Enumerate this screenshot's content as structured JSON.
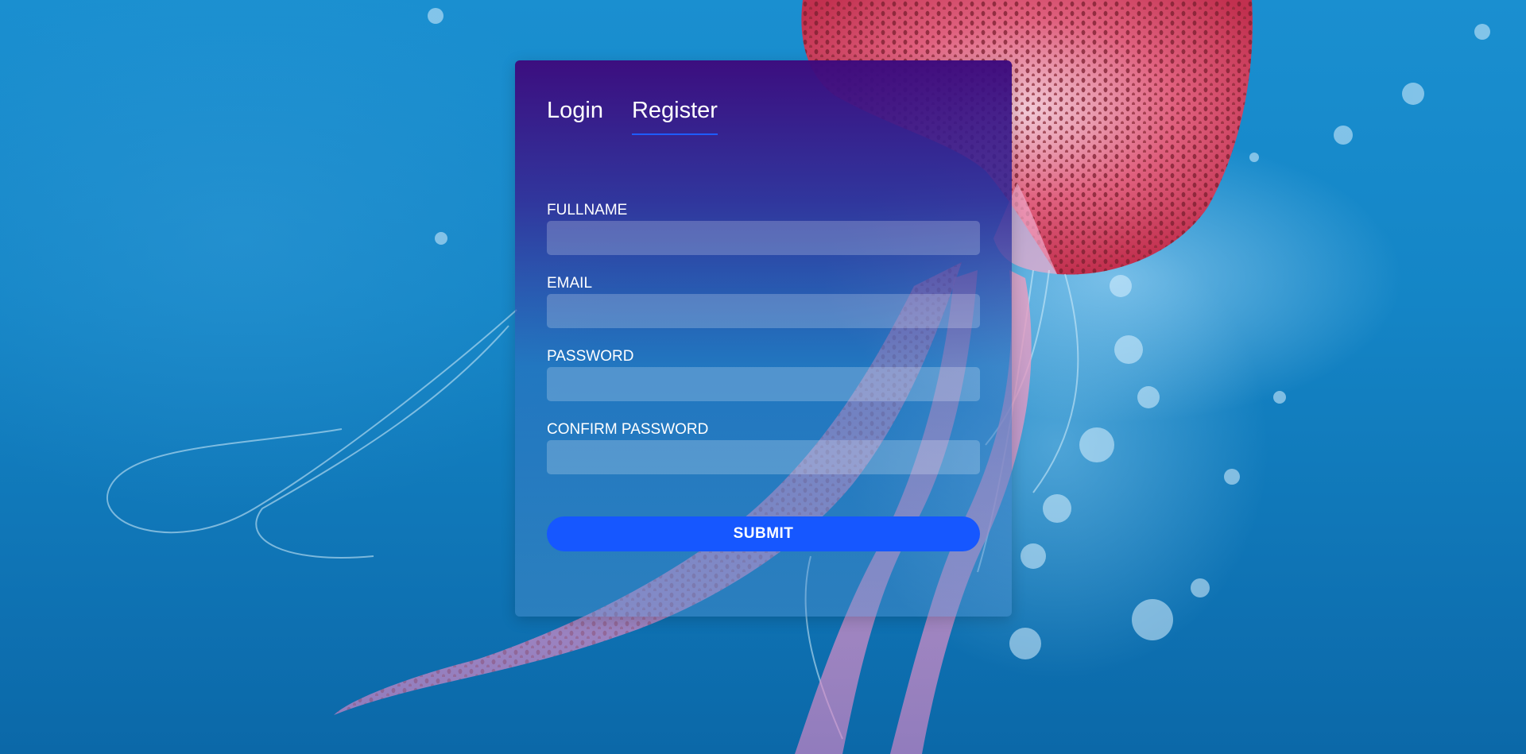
{
  "tabs": [
    {
      "label": "Login",
      "active": false
    },
    {
      "label": "Register",
      "active": true
    }
  ],
  "form": {
    "fields": [
      {
        "label": "FULLNAME",
        "value": "",
        "placeholder": ""
      },
      {
        "label": "EMAIL",
        "value": "",
        "placeholder": ""
      },
      {
        "label": "PASSWORD",
        "value": "",
        "placeholder": ""
      },
      {
        "label": "CONFIRM PASSWORD",
        "value": "",
        "placeholder": ""
      }
    ],
    "submit_label": "SUBMIT"
  },
  "colors": {
    "accent": "#1657ff",
    "card_top": "#3d0a7d",
    "background": "#1485c6"
  },
  "background": {
    "subject": "jellyfish-underwater-photo"
  }
}
